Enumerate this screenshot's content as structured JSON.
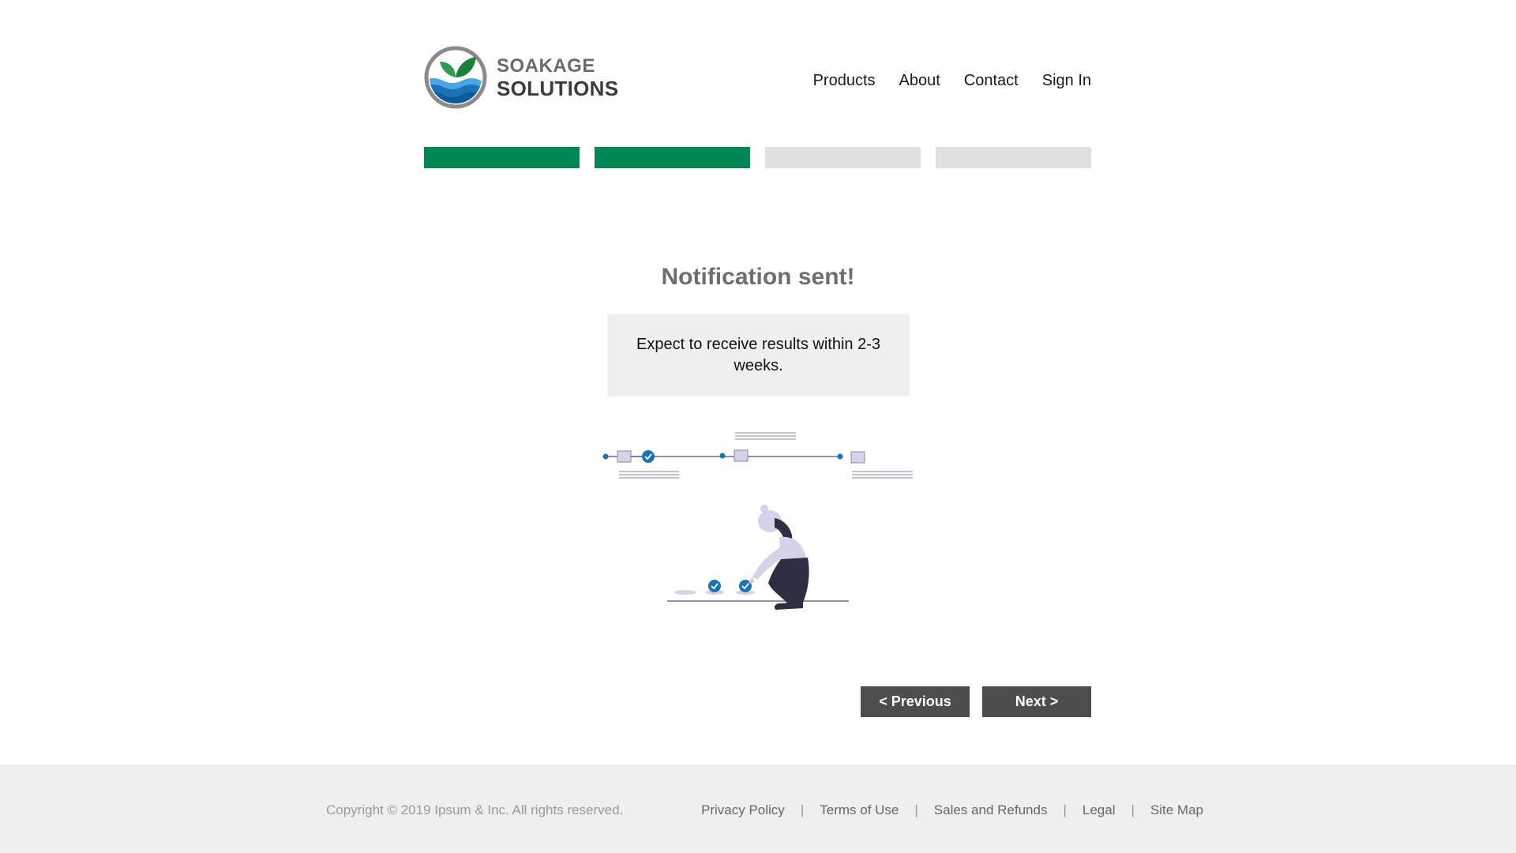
{
  "brand": {
    "line1": "SOAKAGE",
    "line2": "SOLUTIONS",
    "logo_icon": "leaf-water-circle-logo",
    "colors": {
      "leaf": "#1a7f3c",
      "water": "#1a72b8",
      "ring": "#8a8a8a"
    }
  },
  "nav": {
    "items": [
      {
        "label": "Products"
      },
      {
        "label": "About"
      },
      {
        "label": "Contact"
      },
      {
        "label": "Sign In"
      }
    ]
  },
  "progress": {
    "total_steps": 4,
    "completed_steps": 2,
    "colors": {
      "done": "#008755",
      "pending": "#e0e0e0"
    }
  },
  "main": {
    "title": "Notification sent!",
    "message": "Expect to receive results within 2-3 weeks.",
    "illustration": "person-placing-checkmarks-timeline-illustration"
  },
  "buttons": {
    "previous": "< Previous",
    "next": "Next >"
  },
  "footer": {
    "copyright": "Copyright © 2019 Ipsum & Inc. All rights reserved.",
    "links": [
      {
        "label": "Privacy Policy"
      },
      {
        "label": "Terms of Use"
      },
      {
        "label": "Sales and Refunds"
      },
      {
        "label": "Legal"
      },
      {
        "label": "Site Map"
      }
    ],
    "separator": "|"
  }
}
